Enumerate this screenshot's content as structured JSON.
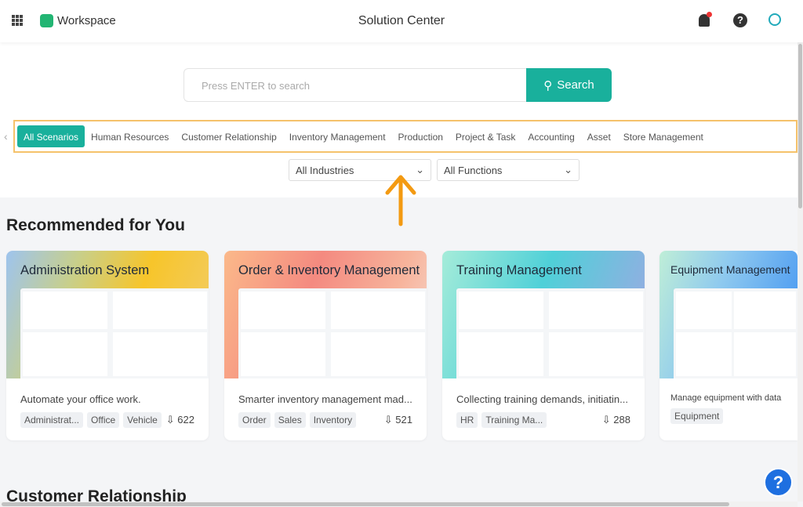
{
  "header": {
    "app_name": "Workspace",
    "title": "Solution Center"
  },
  "search": {
    "placeholder": "Press ENTER to search",
    "button": "Search"
  },
  "tabs": [
    "All Scenarios",
    "Human Resources",
    "Customer Relationship",
    "Inventory Management",
    "Production",
    "Project & Task",
    "Accounting",
    "Asset",
    "Store Management"
  ],
  "filters": {
    "industry": "All Industries",
    "function": "All Functions"
  },
  "section_recommended": "Recommended for You",
  "cards": [
    {
      "title": "Administration System",
      "desc": "Automate your office work.",
      "tags": [
        "Administrat...",
        "Office",
        "Vehicle"
      ],
      "downloads": "622",
      "gradient": "linear-gradient(110deg,#9ec4ee 0%,#c8cf8a 30%,#f7c52a 60%,#f1cd6e 100%)"
    },
    {
      "title": "Order & Inventory Management",
      "desc": "Smarter inventory management mad...",
      "tags": [
        "Order",
        "Sales",
        "Inventory"
      ],
      "downloads": "521",
      "gradient": "linear-gradient(110deg,#fbb98a 0%,#f48a80 40%,#f7b39b 75%,#f6d7cc 100%)"
    },
    {
      "title": "Training Management",
      "desc": "Collecting training demands, initiatin...",
      "tags": [
        "HR",
        "Training Ma..."
      ],
      "downloads": "288",
      "gradient": "linear-gradient(110deg,#a5ecd9 0%,#4fd0d8 45%,#a3a6e4 100%)"
    },
    {
      "title": "Equipment Management",
      "desc": "Manage equipment with data",
      "tags": [
        "Equipment"
      ],
      "downloads": "",
      "gradient": "linear-gradient(110deg,#bfeed7 0%,#8ec9ef 40%,#3b8ff2 100%)"
    }
  ],
  "section_next": "Customer Relationship",
  "colors": {
    "accent": "#19b09c",
    "highlight_border": "#f5c26b",
    "arrow": "#f39a12",
    "help_fab": "#1e6fe0"
  }
}
